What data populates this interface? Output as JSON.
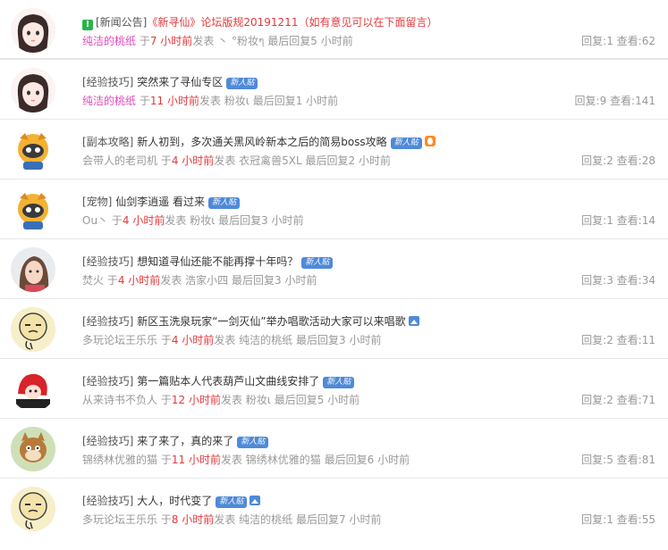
{
  "labels": {
    "pre_time": "于",
    "post_time": "发表",
    "last_reply": "最后回复",
    "reply": "回复:",
    "view": "查看:",
    "new_badge": "新人贴",
    "pin_mark": "!"
  },
  "threads": [
    {
      "category": "[新闻公告]",
      "title": "《新寻仙》论坛版规20191211（如有意见可以在下面留言）",
      "author": "纯洁的桃纸",
      "time": "7 小时前",
      "last_replier": "丶 °粉妆ๆ",
      "last_time": "5 小时前",
      "replies": "1",
      "views": "62"
    },
    {
      "category": "[经验技巧]",
      "title": "突然来了寻仙专区",
      "author": "纯洁的桃纸",
      "time": "11 小时前",
      "last_replier": "粉妆ι",
      "last_time": "1 小时前",
      "replies": "9",
      "views": "141"
    },
    {
      "category": "[副本攻略]",
      "title": "新人初到，多次通关黑风岭新本之后的简易boss攻略",
      "author": "会带人的老司机",
      "time": "4 小时前",
      "last_replier": "衣冠禽兽5XL",
      "last_time": "2 小时前",
      "replies": "2",
      "views": "28"
    },
    {
      "category": "[宠物]",
      "title": "仙剑李逍遥 看过来",
      "author": "Ou丶",
      "time": "4 小时前",
      "last_replier": "粉妆ι",
      "last_time": "3 小时前",
      "replies": "1",
      "views": "14"
    },
    {
      "category": "[经验技巧]",
      "title": "想知道寻仙还能不能再撑十年吗？",
      "author": "焚火",
      "time": "4 小时前",
      "last_replier": "浩家小四",
      "last_time": "3 小时前",
      "replies": "3",
      "views": "34"
    },
    {
      "category": "[经验技巧]",
      "title": "新区玉洗泉玩家“一剑灭仙”举办唱歌活动大家可以来唱歌",
      "author": "多玩论坛王乐乐",
      "time": "4 小时前",
      "last_replier": "纯洁的桃纸",
      "last_time": "3 小时前",
      "replies": "2",
      "views": "11"
    },
    {
      "category": "[经验技巧]",
      "title": "第一篇贴本人代表葫芦山文曲线安排了",
      "author": "从来诗书不负人",
      "time": "12 小时前",
      "last_replier": "粉妆ι",
      "last_time": "5 小时前",
      "replies": "2",
      "views": "71"
    },
    {
      "category": "[经验技巧]",
      "title": "来了来了，真的来了",
      "author": "锦绣林优雅的猫",
      "time": "11 小时前",
      "last_replier": "锦绣林优雅的猫",
      "last_time": "6 小时前",
      "replies": "5",
      "views": "81"
    },
    {
      "category": "[经验技巧]",
      "title": "大人，时代变了",
      "author": "多玩论坛王乐乐",
      "time": "8 小时前",
      "last_replier": "纯洁的桃纸",
      "last_time": "7 小时前",
      "replies": "1",
      "views": "55"
    }
  ]
}
